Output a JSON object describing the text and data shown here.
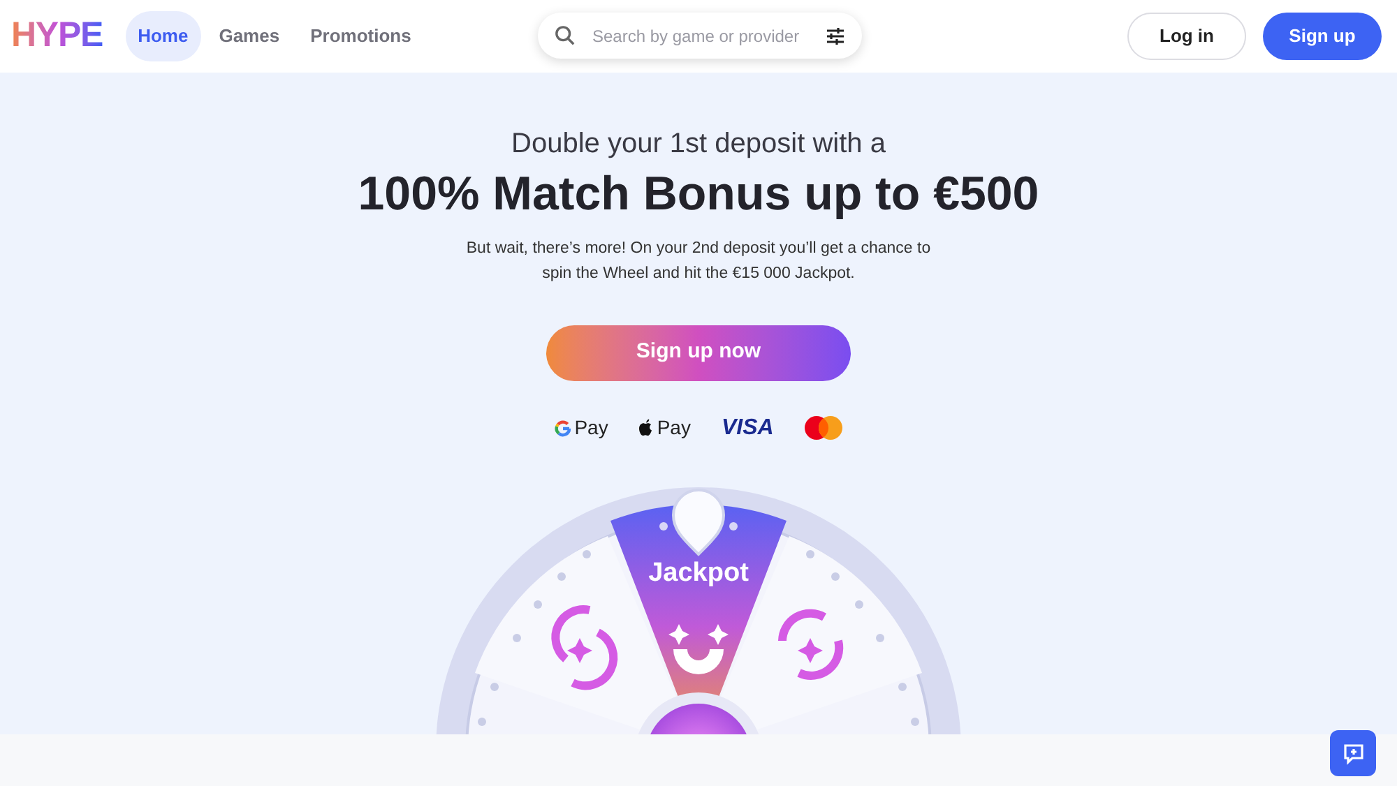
{
  "logo": "HYPE",
  "nav": [
    {
      "label": "Home",
      "selected": true
    },
    {
      "label": "Games",
      "selected": false
    },
    {
      "label": "Promotions",
      "selected": false
    }
  ],
  "search": {
    "placeholder": "Search by game or provider"
  },
  "buttons": {
    "login": "Log in",
    "signup": "Sign up"
  },
  "hero": {
    "kicker": "Double your 1st deposit with a",
    "headline": "100% Match Bonus up to €500",
    "body": "But wait, there’s more! On your 2nd deposit you’ll get a chance to spin the Wheel and hit the €15 000 Jackpot.",
    "cta": "Sign up now"
  },
  "payments": [
    {
      "kind": "gpay",
      "label": "Pay"
    },
    {
      "kind": "applepay",
      "label": "Pay"
    },
    {
      "kind": "visa",
      "label": "VISA"
    },
    {
      "kind": "mastercard"
    }
  ],
  "wheel": {
    "segment_label": "Jackpot"
  }
}
